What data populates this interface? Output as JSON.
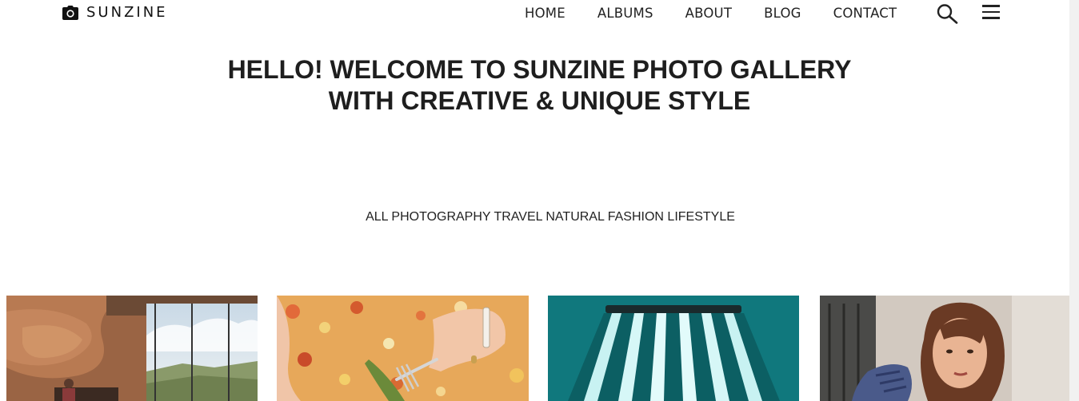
{
  "brand": {
    "name": "SUNZINE",
    "icon": "camera-icon"
  },
  "nav": {
    "items": [
      {
        "label": "HOME"
      },
      {
        "label": "ALBUMS"
      },
      {
        "label": "ABOUT"
      },
      {
        "label": "BLOG"
      },
      {
        "label": "CONTACT"
      }
    ],
    "search_icon": "search-icon",
    "menu_icon": "hamburger-menu-icon"
  },
  "hero": {
    "line1": "HELLO! WELCOME TO SUNZINE PHOTO GALLERY",
    "line2": "WITH CREATIVE & UNIQUE STYLE"
  },
  "filters": [
    "ALL",
    "PHOTOGRAPHY",
    "TRAVEL",
    "NATURAL",
    "FASHION",
    "LIFESTYLE"
  ],
  "gallery": {
    "photos": [
      {
        "subject": "canyon-lounge"
      },
      {
        "subject": "fork-dining"
      },
      {
        "subject": "teal-light-stripes"
      },
      {
        "subject": "woman-portrait"
      }
    ]
  },
  "colors": {
    "text": "#222222",
    "background": "#ffffff"
  }
}
